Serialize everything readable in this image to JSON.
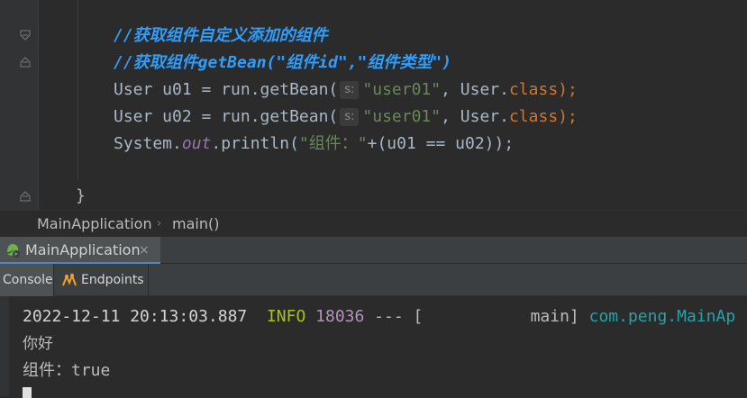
{
  "editor": {
    "comment1": "//获取组件自定义添加的组件",
    "comment2": "//获取组件getBean(\"组件id\",\"组件类型\")",
    "line3": {
      "before_hint": "User u01 = run.getBean(",
      "hint": "s:",
      "arg": "\"user01\"",
      "mid": ", User.",
      "kw": "class",
      "end": ");"
    },
    "line4": {
      "before_hint": "User u02 = run.getBean(",
      "hint": "s:",
      "arg": "\"user01\"",
      "mid": ", User.",
      "kw": "class",
      "end": ");"
    },
    "line5": {
      "prefix": "System.",
      "field": "out",
      "call": ".println(",
      "str": "\"组件：\"",
      "rest": "+(u01 == u02));"
    },
    "closing_brace": "}"
  },
  "breadcrumb": {
    "class_name": "MainApplication",
    "separator": "›",
    "method": "main()"
  },
  "run_tab": {
    "label": "MainApplication",
    "icon": "spring-run-icon",
    "close": "×"
  },
  "tool_tabs": {
    "console": "Console",
    "endpoints": "Endpoints",
    "endpoints_icon": "endpoints-icon"
  },
  "console": {
    "log": {
      "timestamp": "2022-12-11 20:13:03.887",
      "level": "INFO",
      "pid": "18036",
      "sep": "--- [",
      "thread": "main]",
      "logger": "com.peng.MainAp"
    },
    "out1": "你好",
    "out2": "组件：true"
  },
  "colors": {
    "comment": "#2f9dfc",
    "keyword": "#cc7832",
    "string": "#6a8759",
    "field": "#9876aa",
    "log_level": "#a8c023",
    "logger": "#2aa1a8"
  }
}
